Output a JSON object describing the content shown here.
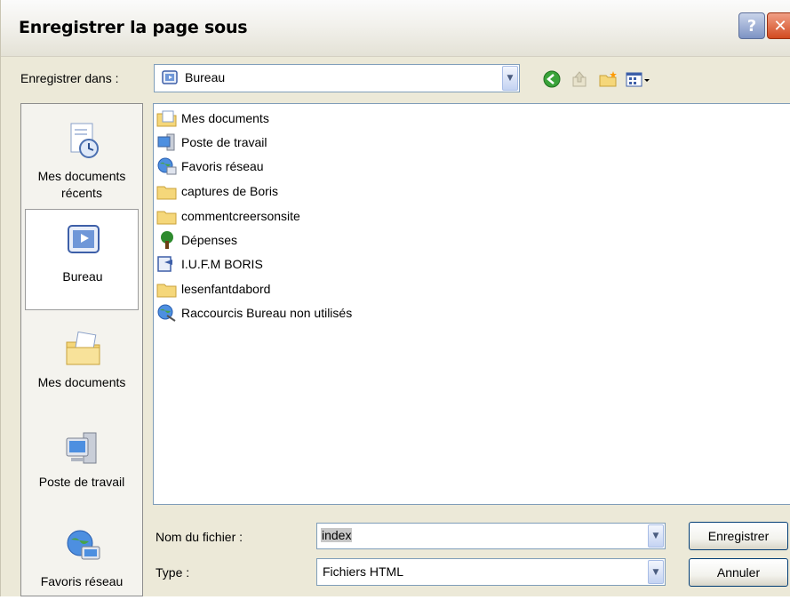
{
  "window": {
    "title": "Enregistrer la page sous",
    "help_label": "?",
    "close_label": "✕"
  },
  "save_in": {
    "label": "Enregistrer dans :",
    "value": "Bureau",
    "toolbar_icons": [
      "back-icon",
      "up-folder-icon",
      "new-folder-icon",
      "view-menu-icon"
    ]
  },
  "places": [
    {
      "label": "Mes documents récents",
      "icon": "recent-documents-icon"
    },
    {
      "label": "Bureau",
      "icon": "desktop-icon",
      "selected": true
    },
    {
      "label": "Mes documents",
      "icon": "my-documents-icon"
    },
    {
      "label": "Poste de travail",
      "icon": "my-computer-icon"
    },
    {
      "label": "Favoris réseau",
      "icon": "network-places-icon"
    }
  ],
  "files": [
    {
      "name": "Mes documents",
      "icon": "documents-folder-icon"
    },
    {
      "name": "Poste de travail",
      "icon": "computer-icon"
    },
    {
      "name": "Favoris réseau",
      "icon": "network-icon"
    },
    {
      "name": "captures de Boris",
      "icon": "folder-icon"
    },
    {
      "name": "commentcreersonsite",
      "icon": "folder-icon"
    },
    {
      "name": "Dépenses",
      "icon": "tree-icon"
    },
    {
      "name": "I.U.F.M BORIS",
      "icon": "shortcut-icon"
    },
    {
      "name": "lesenfantdabord",
      "icon": "folder-icon"
    },
    {
      "name": "Raccourcis Bureau non utilisés",
      "icon": "cleanup-icon"
    }
  ],
  "filename": {
    "label": "Nom du fichier :",
    "value": "index"
  },
  "filetype": {
    "label": "Type :",
    "value": "Fichiers HTML"
  },
  "buttons": {
    "save": "Enregistrer",
    "cancel": "Annuler"
  },
  "colors": {
    "dialog_bg": "#ece9d8",
    "border_blue": "#7f9db9",
    "button_border": "#003c74",
    "folder_yellow": "#f5d77a"
  }
}
